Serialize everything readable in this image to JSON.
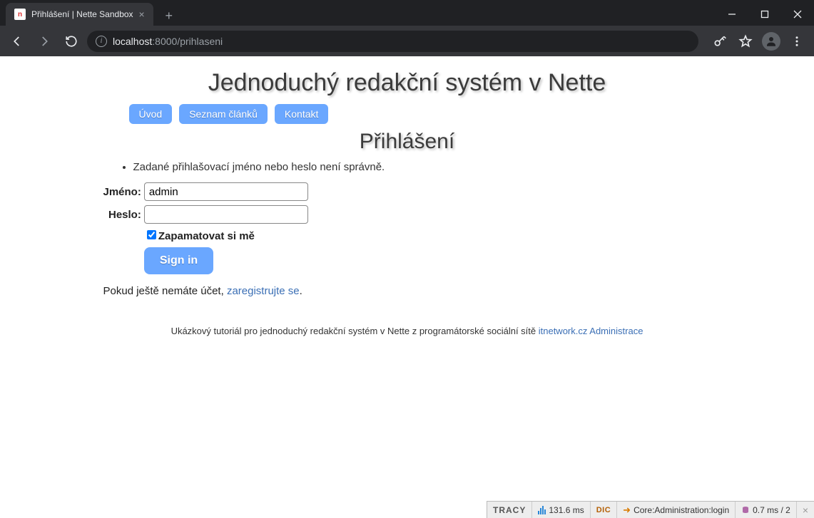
{
  "browser": {
    "tab_title": "Přihlášení | Nette Sandbox",
    "url_host": "localhost",
    "url_port": ":8000",
    "url_path": "/prihlaseni"
  },
  "page": {
    "site_title": "Jednoduchý redakční systém v Nette",
    "nav": [
      "Úvod",
      "Seznam článků",
      "Kontakt"
    ],
    "heading": "Přihlášení",
    "error": "Zadané přihlašovací jméno nebo heslo není správně.",
    "form": {
      "username_label": "Jméno:",
      "username_value": "admin",
      "password_label": "Heslo:",
      "password_value": "",
      "remember_checked": true,
      "remember_label": "Zapamatovat si mě",
      "submit_label": "Sign in"
    },
    "register_prefix": "Pokud ještě nemáte účet, ",
    "register_link": "zaregistrujte se",
    "register_suffix": ".",
    "footer_text": "Ukázkový tutoriál pro jednoduchý redakční systém v Nette z programátorské sociální sítě ",
    "footer_link1": "itnetwork.cz",
    "footer_sep": " ",
    "footer_link2": "Administrace"
  },
  "tracy": {
    "logo": "TRACY",
    "time": "131.6 ms",
    "dic": "DIC",
    "route": "Core:Administration:login",
    "db": "0.7 ms / 2",
    "close": "×"
  }
}
